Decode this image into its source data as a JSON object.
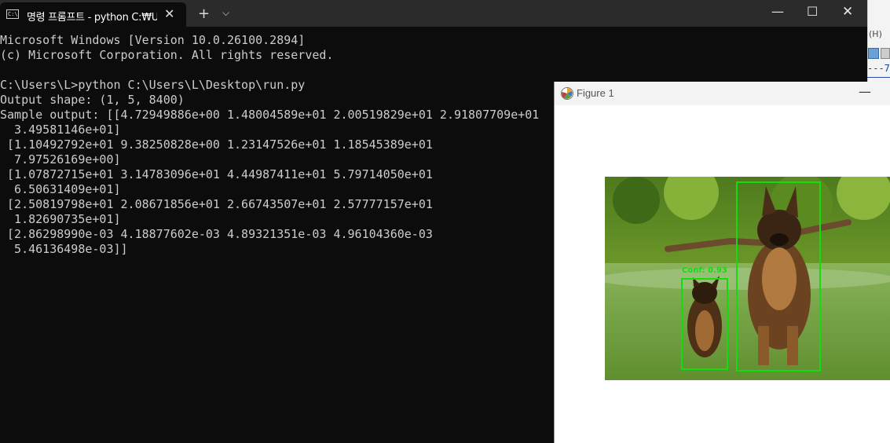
{
  "terminal": {
    "tab_title": "명령 프롬프트 - python  C:₩Users₩L₩Desktop₩run.py",
    "new_tab_label": "+",
    "close_tab_label": "✕",
    "lines": [
      "Microsoft Windows [Version 10.0.26100.2894]",
      "(c) Microsoft Corporation. All rights reserved.",
      "",
      "C:\\Users\\L>python C:\\Users\\L\\Desktop\\run.py",
      "Output shape: (1, 5, 8400)",
      "Sample output: [[4.72949886e+00 1.48004589e+01 2.00519829e+01 2.91807709e+01",
      "  3.49581146e+01]",
      " [1.10492792e+01 9.38250828e+00 1.23147526e+01 1.18545389e+01",
      "  7.97526169e+00]",
      " [1.07872715e+01 3.14783096e+01 4.44987411e+01 5.79714050e+01",
      "  6.50631409e+01]",
      " [2.50819798e+01 2.08671856e+01 2.66743507e+01 2.57777157e+01",
      "  1.82690735e+01]",
      " [2.86298990e-03 4.18877602e-03 4.89321351e-03 4.96104360e-03",
      "  5.46136498e-03]]"
    ]
  },
  "figure": {
    "title": "Figure 1",
    "detections": [
      {
        "label": "Conf: 0.93"
      },
      {
        "label": ""
      }
    ]
  },
  "background_app": {
    "menu_text": "(H)",
    "dash_text": "---7"
  },
  "colors": {
    "terminal_bg": "#0c0c0c",
    "terminal_text": "#cccccc",
    "detection_box": "#11dd11"
  }
}
